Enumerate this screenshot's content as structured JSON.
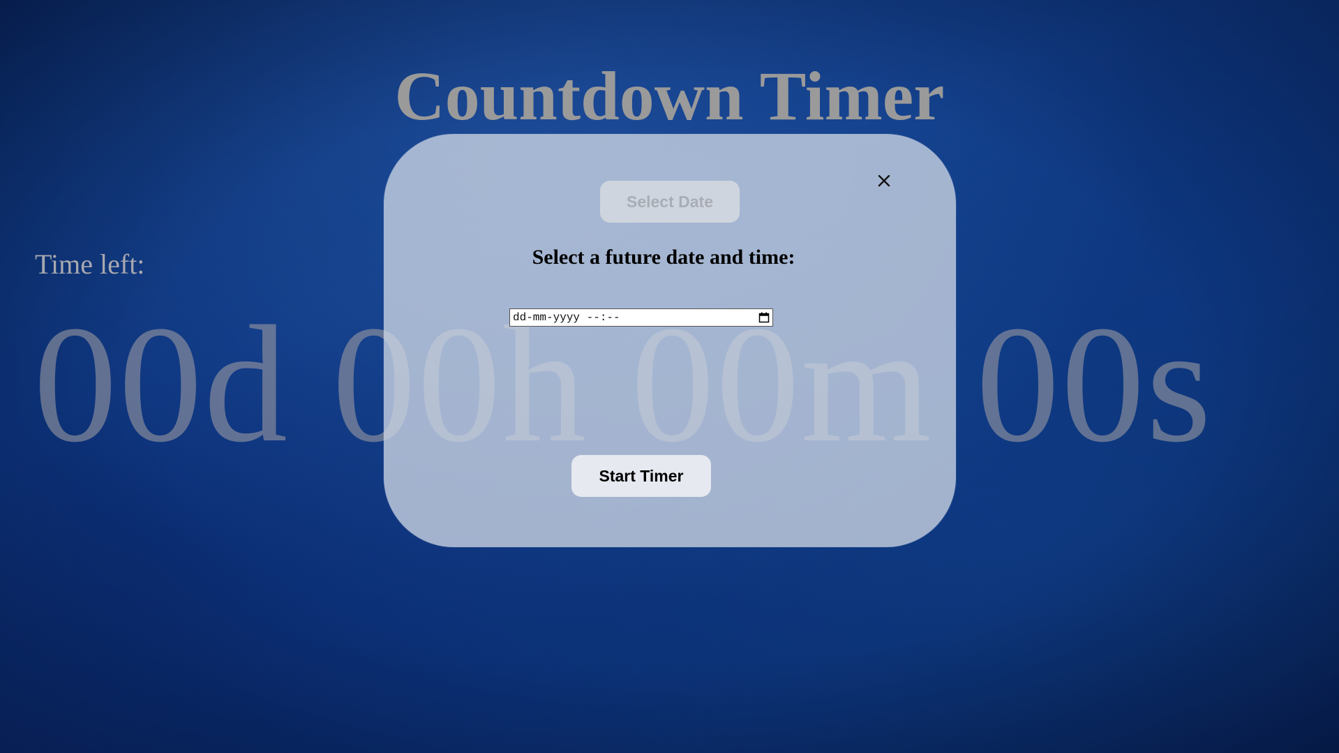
{
  "page": {
    "title": "Countdown Timer",
    "time_left_label": "Time left:",
    "countdown_display": "00d 00h 00m 00s"
  },
  "modal": {
    "select_date_label": "Select Date",
    "prompt": "Select a future date and time:",
    "date_input_placeholder": "dd-mm-yyyy --:--",
    "start_button_label": "Start Timer",
    "close_icon": "close-icon",
    "calendar_icon": "calendar-icon"
  },
  "colors": {
    "background": "#0b3278",
    "title": "#9a9a9a",
    "modal_background": "#cdd6e4",
    "countdown_text": "#9696a0"
  }
}
